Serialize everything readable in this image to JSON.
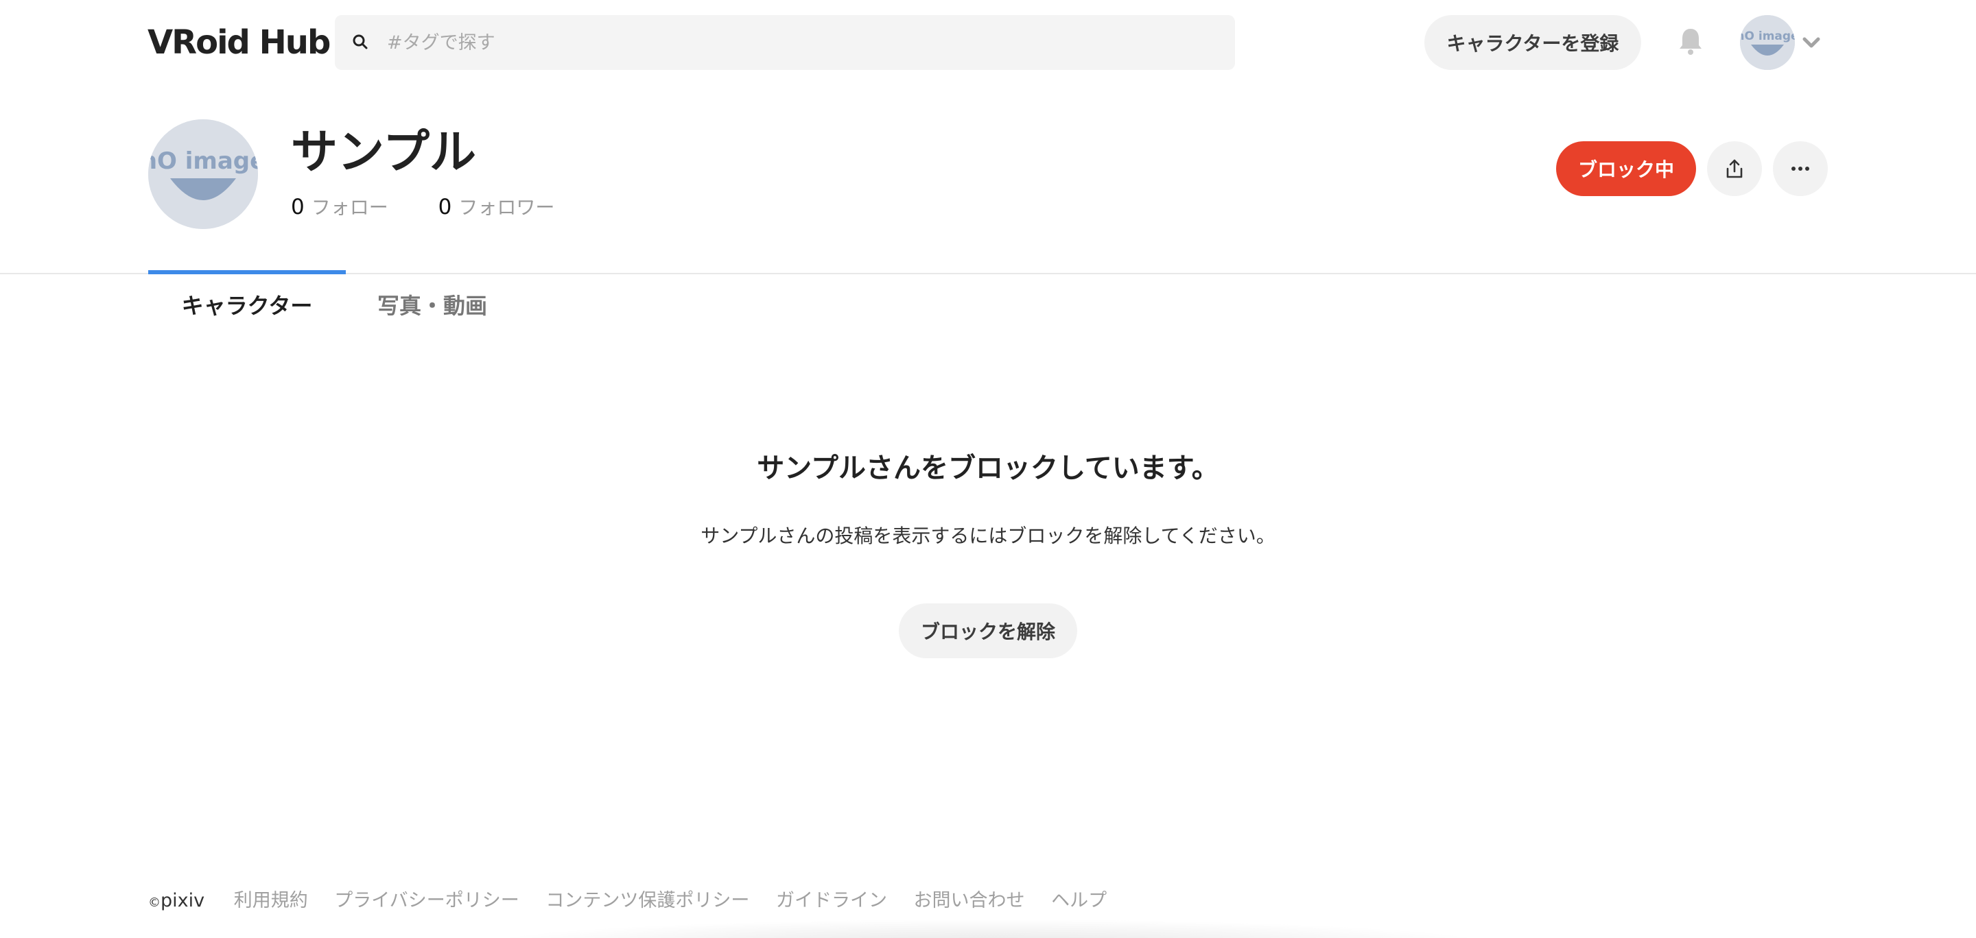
{
  "header": {
    "logo_text": "VRoid Hub",
    "search_placeholder": "#タグで探す",
    "register_label": "キャラクターを登録"
  },
  "profile": {
    "name": "サンプル",
    "follow_count": "0",
    "follow_label": "フォロー",
    "follower_count": "0",
    "follower_label": "フォロワー",
    "blocked_label": "ブロック中"
  },
  "tabs": [
    {
      "label": "キャラクター",
      "active": true
    },
    {
      "label": "写真・動画",
      "active": false
    }
  ],
  "blocked": {
    "title": "サンプルさんをブロックしています。",
    "description": "サンプルさんの投稿を表示するにはブロックを解除してください。",
    "unblock_label": "ブロックを解除"
  },
  "footer": {
    "copyright_symbol": "©",
    "copyright_text": "pixiv",
    "links": [
      "利用規約",
      "プライバシーポリシー",
      "コンテンツ保護ポリシー",
      "ガイドライン",
      "お問い合わせ",
      "ヘルプ"
    ]
  },
  "colors": {
    "accent": "#e8412a",
    "tab_indicator": "#3d8ae8"
  },
  "icons": {
    "search": "search-icon",
    "bell": "bell-icon",
    "chevron": "chevron-down-icon",
    "share": "share-icon",
    "more": "more-horizontal-icon"
  }
}
